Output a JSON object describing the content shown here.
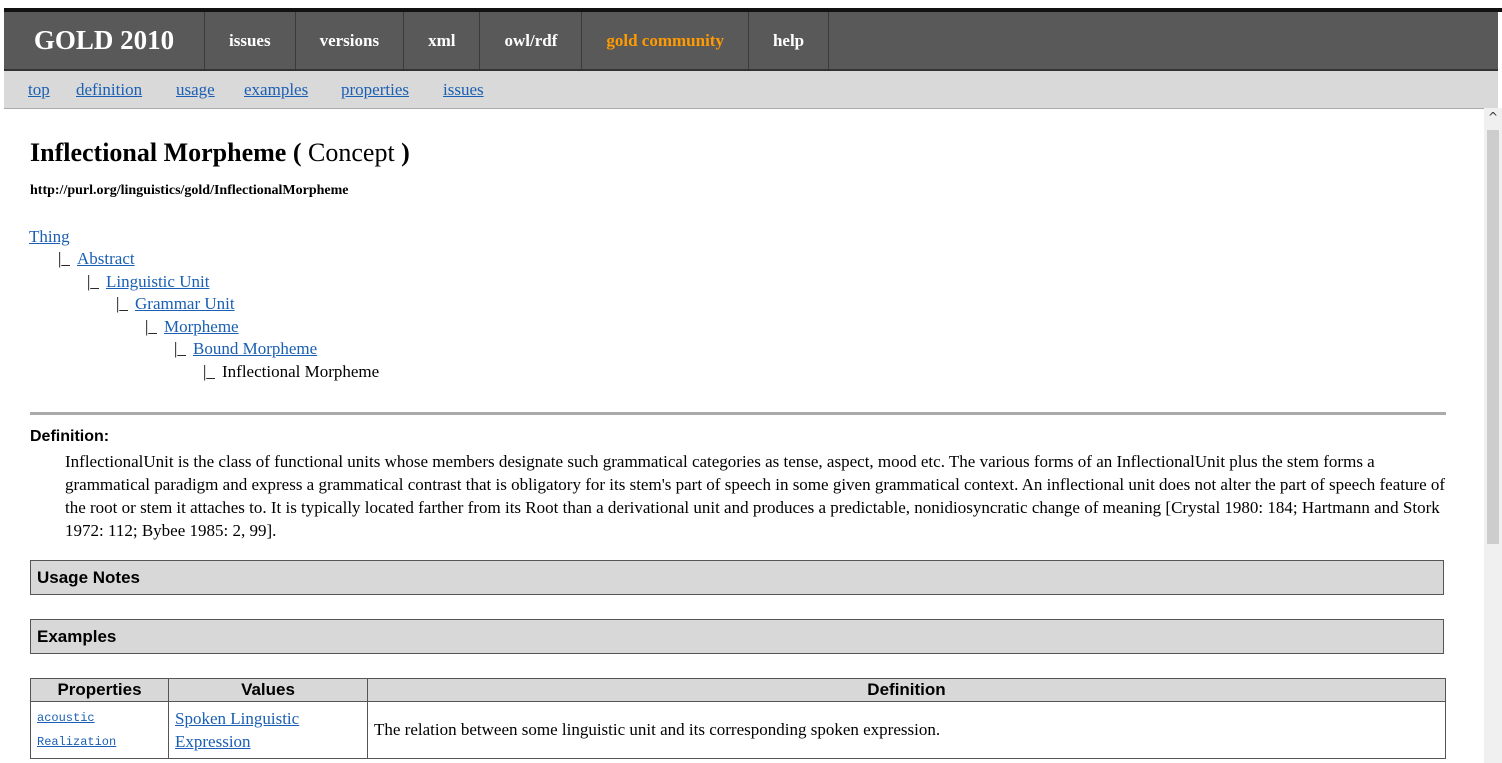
{
  "nav": {
    "brand": "GOLD 2010",
    "items": [
      "issues",
      "versions",
      "xml",
      "owl/rdf",
      "gold community",
      "help"
    ]
  },
  "subnav": [
    "top",
    "definition",
    "usage",
    "examples",
    "properties",
    "issues"
  ],
  "page": {
    "title": "Inflectional Morpheme",
    "title_paren_open": "(",
    "title_kind": "Concept",
    "title_paren_close": ")",
    "uri": "http://purl.org/linguistics/gold/InflectionalMorpheme"
  },
  "hierarchy": {
    "branch_glyph": "|_",
    "items": [
      "Thing",
      "Abstract",
      "Linguistic Unit",
      "Grammar Unit",
      "Morpheme",
      "Bound Morpheme"
    ],
    "current": "Inflectional Morpheme"
  },
  "definition": {
    "label": "Definition:",
    "text": "InflectionalUnit is the class of functional units whose members designate such grammatical categories as tense, aspect, mood etc. The various forms of an InflectionalUnit plus the stem forms a grammatical paradigm and express a grammatical contrast that is obligatory for its stem's part of speech in some given grammatical context. An inflectional unit does not alter the part of speech feature of the root or stem it attaches to. It is typically located farther from its Root than a derivational unit and produces a predictable, nonidiosyncratic change of meaning [Crystal 1980: 184; Hartmann and Stork 1972: 112; Bybee 1985: 2, 99]."
  },
  "sections": {
    "usage": "Usage Notes",
    "examples": "Examples"
  },
  "properties_table": {
    "headers": [
      "Properties",
      "Values",
      "Definition"
    ],
    "rows": [
      {
        "property_line1": "acoustic",
        "property_line2": "Realization",
        "value_line1": "Spoken Linguistic",
        "value_line2": "Expression",
        "definition": "The relation between some linguistic unit and its corresponding spoken expression."
      }
    ]
  },
  "scrollbar": {
    "up_arrow": "^"
  }
}
